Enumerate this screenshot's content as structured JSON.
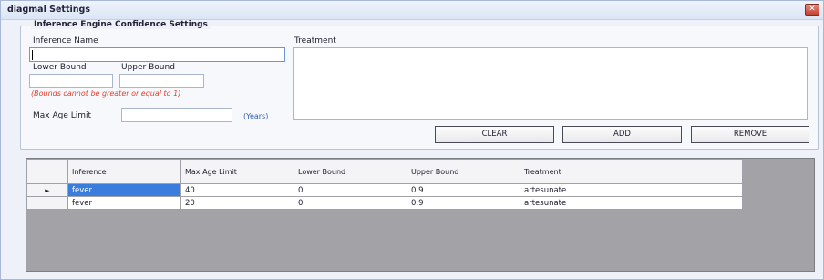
{
  "window": {
    "title": "diagmal Settings",
    "close_label": "✕"
  },
  "group": {
    "title": "Inference Engine Confidence Settings"
  },
  "form": {
    "inference_name_label": "Inference Name",
    "inference_name_value": "",
    "lower_bound_label": "Lower Bound",
    "upper_bound_label": "Upper Bound",
    "lower_bound_value": "",
    "upper_bound_value": "",
    "bounds_hint": "(Bounds cannot be greater or equal to 1)",
    "max_age_label": "Max Age Limit",
    "max_age_value": "",
    "years_hint": "(Years)",
    "treatment_label": "Treatment",
    "treatment_value": ""
  },
  "buttons": {
    "clear": "CLEAR",
    "add": "ADD",
    "remove": "REMOVE"
  },
  "grid": {
    "columns": [
      {
        "key": "inference",
        "label": "Inference"
      },
      {
        "key": "max_age",
        "label": "Max Age Limit"
      },
      {
        "key": "lower",
        "label": "Lower Bound"
      },
      {
        "key": "upper",
        "label": "Upper Bound"
      },
      {
        "key": "treatment",
        "label": "Treatment"
      }
    ],
    "rows": [
      {
        "current": true,
        "inference": "fever",
        "max_age": "40",
        "lower": "0",
        "upper": "0.9",
        "treatment": "artesunate"
      },
      {
        "current": false,
        "inference": "fever",
        "max_age": "20",
        "lower": "0",
        "upper": "0.9",
        "treatment": "artesunate"
      }
    ],
    "current_row_marker": "►"
  },
  "colors": {
    "selection": "#3b7ddd",
    "error_hint": "#e2412d",
    "info_hint": "#2b5bb8",
    "grid_background": "#a3a3a7"
  }
}
